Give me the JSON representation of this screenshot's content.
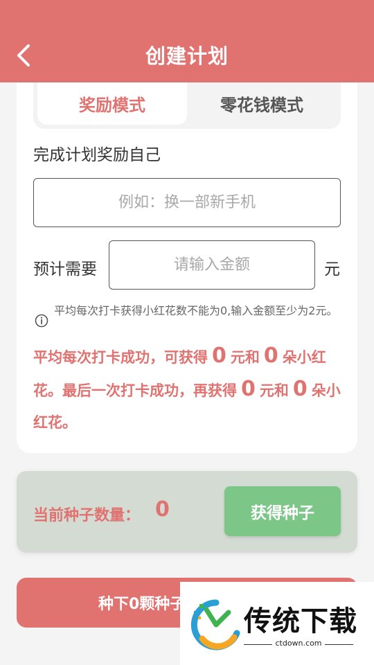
{
  "header": {
    "title": "创建计划",
    "background_color": "#e07270"
  },
  "mode_tabs": [
    {
      "label": "奖励模式",
      "active": true
    },
    {
      "label": "零花钱模式",
      "active": false
    }
  ],
  "reward_section": {
    "label": "完成计划奖励自己",
    "input_placeholder": "例如：换一部新手机",
    "input_value": ""
  },
  "amount_section": {
    "label": "预计需要",
    "input_placeholder": "请输入金额",
    "input_value": "",
    "unit": "元"
  },
  "hint": {
    "icon": "info-icon",
    "text": "平均每次打卡获得小红花数不能为0,输入金额至少为2元。"
  },
  "summary": {
    "part1": "平均每次打卡成功，可获得",
    "per_checkin_yuan": "0",
    "part2": "元和",
    "per_checkin_flowers": "0",
    "part3": "朵小红花。最后一次打卡成功，再获得",
    "final_yuan": "0",
    "part4": "元和",
    "final_flowers": "0",
    "part5": "朵小红花。",
    "accent_color": "#e07270"
  },
  "seeds": {
    "label": "当前种子数量：",
    "count": "0",
    "button_label": "获得种子",
    "button_color": "#7cc788"
  },
  "plant_button": {
    "label": "种下0颗种子"
  },
  "watermark": {
    "title": "传统下载",
    "domain": "ctdown.com"
  }
}
